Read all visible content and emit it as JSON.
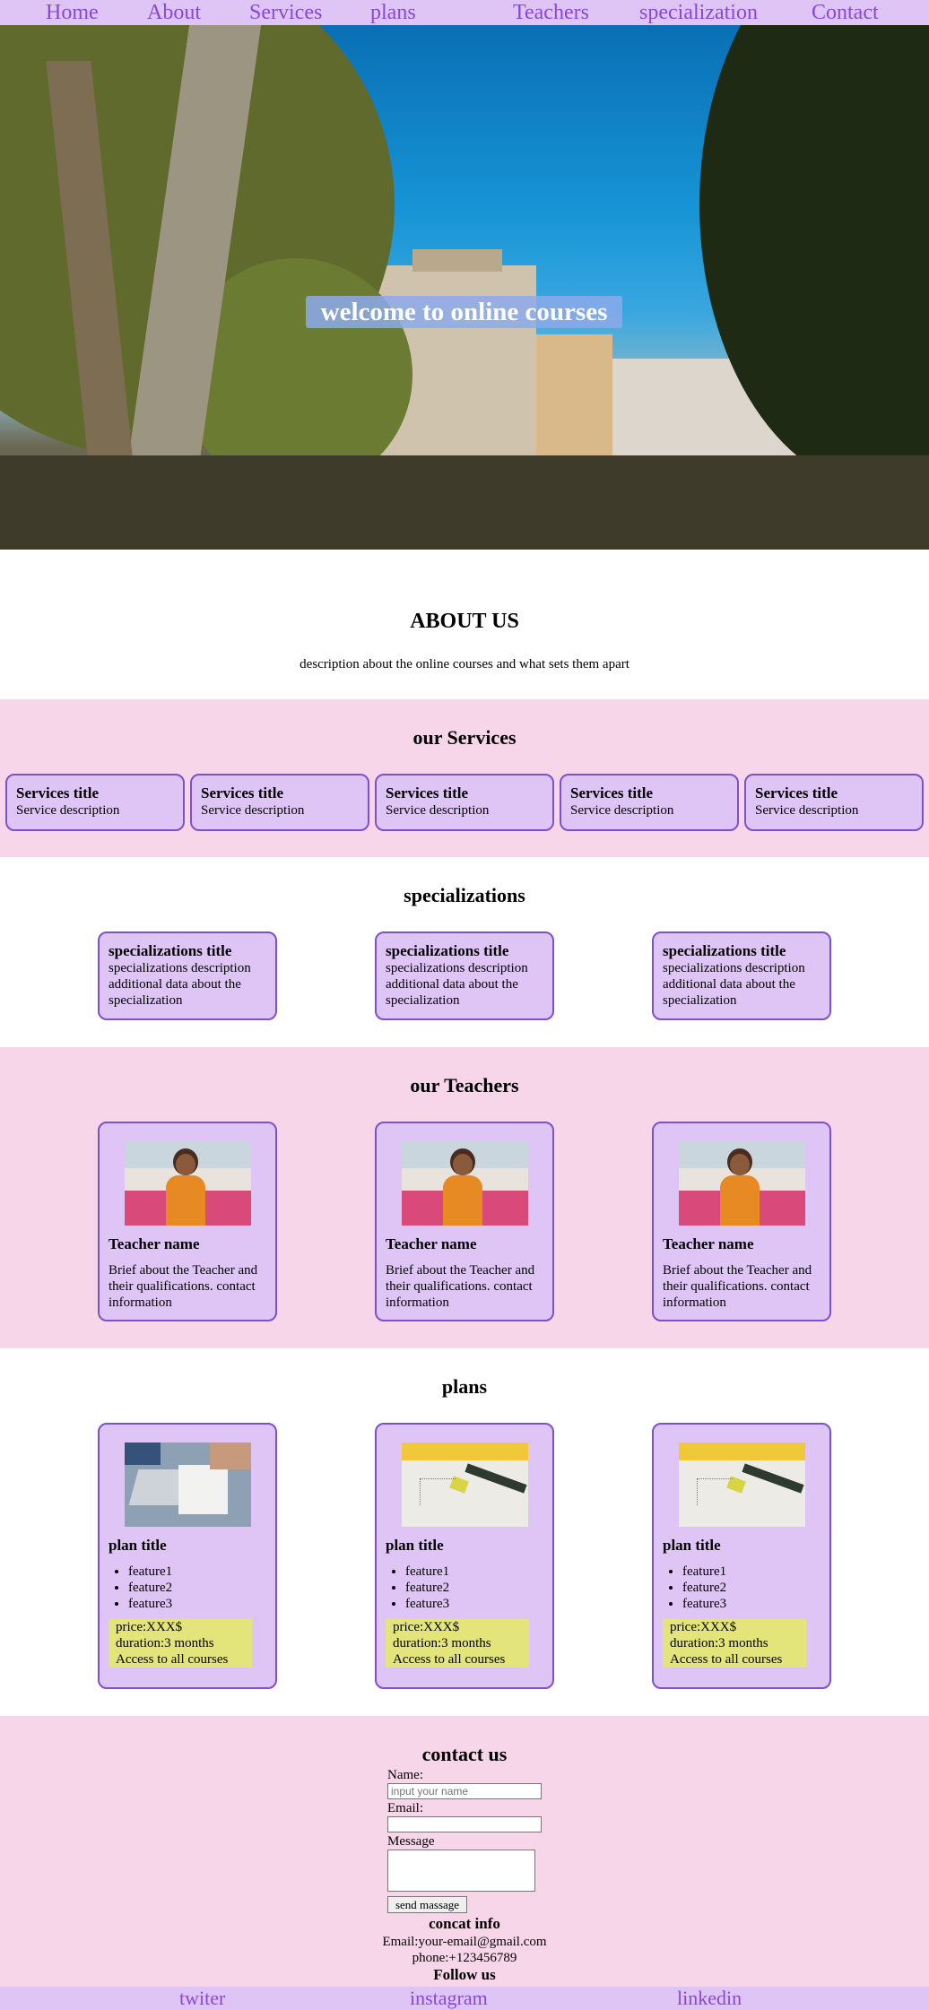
{
  "nav": {
    "items": [
      "Home",
      "About",
      "Services",
      "plans",
      "Teachers",
      "specialization",
      "Contact"
    ]
  },
  "hero": {
    "title": "welcome to online courses"
  },
  "about": {
    "title": "ABOUT US",
    "description": "description about the online courses and what sets them apart"
  },
  "services": {
    "title": "our Services",
    "cards": [
      {
        "title": "Services title",
        "description": "Service description"
      },
      {
        "title": "Services title",
        "description": "Service description"
      },
      {
        "title": "Services title",
        "description": "Service description"
      },
      {
        "title": "Services title",
        "description": "Service description"
      },
      {
        "title": "Services title",
        "description": "Service description"
      }
    ]
  },
  "specializations": {
    "title": "specializations",
    "cards": [
      {
        "title": "specializations title",
        "description": "specializations description additional data about the specialization"
      },
      {
        "title": "specializations title",
        "description": "specializations description additional data about the specialization"
      },
      {
        "title": "specializations title",
        "description": "specializations description additional data about the specialization"
      }
    ]
  },
  "teachers": {
    "title": "our Teachers",
    "cards": [
      {
        "name": "Teacher name",
        "brief": "Brief about the Teacher and their qualifications. contact information"
      },
      {
        "name": "Teacher name",
        "brief": "Brief about the Teacher and their qualifications. contact information"
      },
      {
        "name": "Teacher name",
        "brief": "Brief about the Teacher and their qualifications. contact information"
      }
    ]
  },
  "plans": {
    "title": "plans",
    "cards": [
      {
        "title": "plan title",
        "features": [
          "feature1",
          "feature2",
          "feature3"
        ],
        "price": "price:XXX$",
        "duration": "duration:3 months",
        "access": "Access to all courses"
      },
      {
        "title": "plan title",
        "features": [
          "feature1",
          "feature2",
          "feature3"
        ],
        "price": "price:XXX$",
        "duration": "duration:3 months",
        "access": "Access to all courses"
      },
      {
        "title": "plan title",
        "features": [
          "feature1",
          "feature2",
          "feature3"
        ],
        "price": "price:XXX$",
        "duration": "duration:3 months",
        "access": "Access to all courses"
      }
    ]
  },
  "contact": {
    "title": "contact us",
    "name_label": "Name:",
    "name_placeholder": "input your name",
    "email_label": "Email:",
    "message_label": "Message",
    "send_label": "send massage",
    "info_title": "concat info",
    "email": "Email:your-email@gmail.com",
    "phone": "phone:+123456789",
    "follow_title": "Follow us"
  },
  "footer": {
    "links": [
      "twiter",
      "instagram",
      "linkedin"
    ]
  },
  "colors": {
    "nav_bg": "#dfc5f6",
    "link": "#8a47d6",
    "section_pink": "#f8d6ea",
    "card": "#dfc5f6",
    "card_border": "#7b52c8",
    "price_bg": "#e3e57a"
  }
}
